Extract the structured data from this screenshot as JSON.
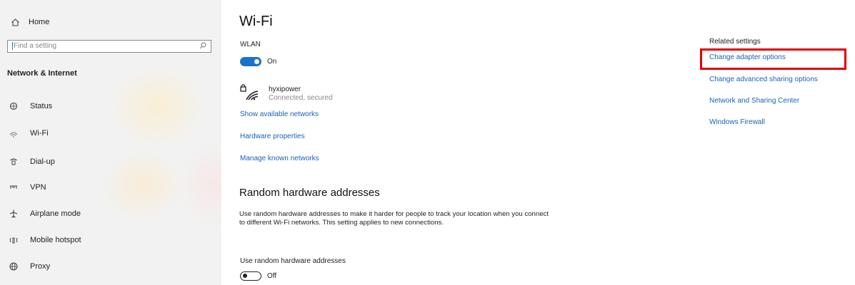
{
  "sidebar": {
    "home_label": "Home",
    "search_placeholder": "Find a setting",
    "section_title": "Network & Internet",
    "items": [
      {
        "label": "Status",
        "icon": "status-icon"
      },
      {
        "label": "Wi-Fi",
        "icon": "wifi-icon"
      },
      {
        "label": "Dial-up",
        "icon": "dialup-icon"
      },
      {
        "label": "VPN",
        "icon": "vpn-icon"
      },
      {
        "label": "Airplane mode",
        "icon": "airplane-icon"
      },
      {
        "label": "Mobile hotspot",
        "icon": "hotspot-icon"
      },
      {
        "label": "Proxy",
        "icon": "globe-icon"
      }
    ]
  },
  "main": {
    "title": "Wi-Fi",
    "wlan_label": "WLAN",
    "wlan_toggle": "On",
    "network": {
      "name": "hyxipower",
      "status": "Connected, secured"
    },
    "links": {
      "show_networks": "Show available networks",
      "hardware_props": "Hardware properties",
      "manage_known": "Manage known networks"
    },
    "random_hw": {
      "title": "Random hardware addresses",
      "description": "Use random hardware addresses to make it harder for people to track your location when you connect to different Wi-Fi networks. This setting applies to new connections.",
      "toggle_label": "Use random hardware addresses",
      "toggle_state": "Off"
    }
  },
  "related": {
    "title": "Related settings",
    "links": [
      "Change adapter options",
      "Change advanced sharing options",
      "Network and Sharing Center",
      "Windows Firewall"
    ]
  },
  "colors": {
    "accent": "#1a73c8",
    "link": "#1a62b8",
    "highlight": "#e00000"
  }
}
